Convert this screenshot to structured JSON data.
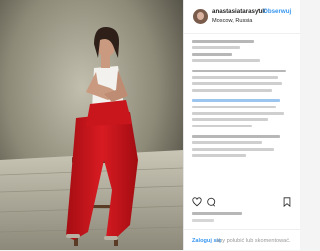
{
  "post": {
    "username": "anastasiatarasyuk",
    "separator": "•",
    "follow_label": "Obserwuj",
    "location": "Moscow, Russia",
    "login_link": "Zaloguj się",
    "login_suffix": "aby polubić lub skomentować."
  },
  "icons": {
    "like": "heart-icon",
    "comment": "comment-icon",
    "save": "bookmark-icon"
  },
  "colors": {
    "accent": "#3897f0",
    "dress": "#c8161c",
    "background": "#6f6a5d"
  }
}
